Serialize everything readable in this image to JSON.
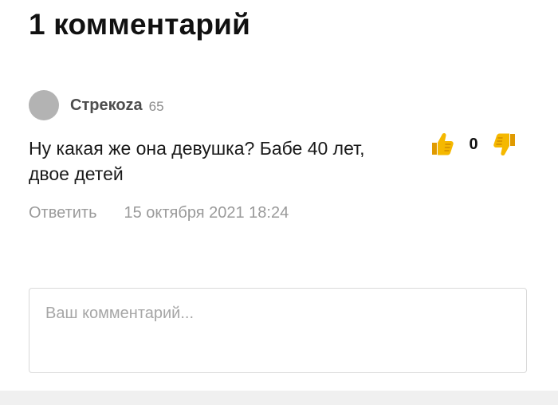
{
  "comments_section": {
    "heading": "1 комментарий"
  },
  "comment": {
    "author": "Стрекоzа",
    "author_rating": "65",
    "text": "Ну какая же она девушка? Бабе 40 лет, двое детей",
    "votes": {
      "count": "0",
      "like_icon": "thumbs-up-icon",
      "dislike_icon": "thumbs-down-icon"
    },
    "reply_label": "Ответить",
    "timestamp": "15 октября 2021 18:24"
  },
  "comment_form": {
    "placeholder": "Ваш комментарий..."
  },
  "colors": {
    "avatar": "#b3b3b3",
    "thumb": "#f5b800",
    "muted_text": "#9a9a9a"
  }
}
